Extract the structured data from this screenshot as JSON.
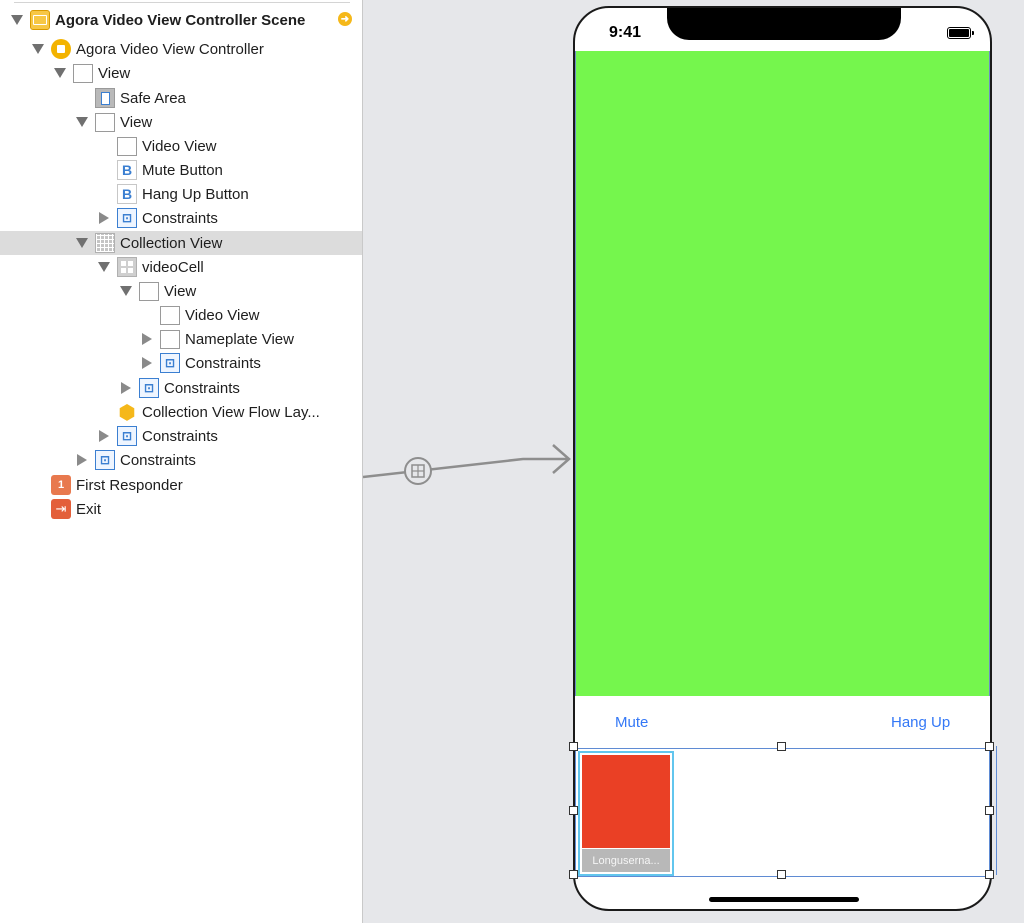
{
  "outline": {
    "rows": [
      {
        "label": "Agora Video View Controller Scene"
      },
      {
        "label": "Agora Video View Controller"
      },
      {
        "label": "View"
      },
      {
        "label": "Safe Area"
      },
      {
        "label": "View"
      },
      {
        "label": "Video View"
      },
      {
        "label": "Mute Button"
      },
      {
        "label": "Hang Up Button"
      },
      {
        "label": "Constraints"
      },
      {
        "label": "Collection View"
      },
      {
        "label": "videoCell"
      },
      {
        "label": "View"
      },
      {
        "label": "Video View"
      },
      {
        "label": "Nameplate View"
      },
      {
        "label": "Constraints"
      },
      {
        "label": "Constraints"
      },
      {
        "label": "Collection View Flow Lay..."
      },
      {
        "label": "Constraints"
      },
      {
        "label": "Constraints"
      },
      {
        "label": "First Responder"
      },
      {
        "label": "Exit"
      }
    ],
    "selected_row": "Collection View"
  },
  "phone": {
    "status_time": "9:41",
    "mute_label": "Mute",
    "hangup_label": "Hang Up",
    "nameplate_text": "Longuserna..."
  },
  "colors": {
    "video_view": "#75f64d",
    "cell_video": "#ea4025",
    "button_text": "#3478f6",
    "selection": "#62c6ee"
  }
}
